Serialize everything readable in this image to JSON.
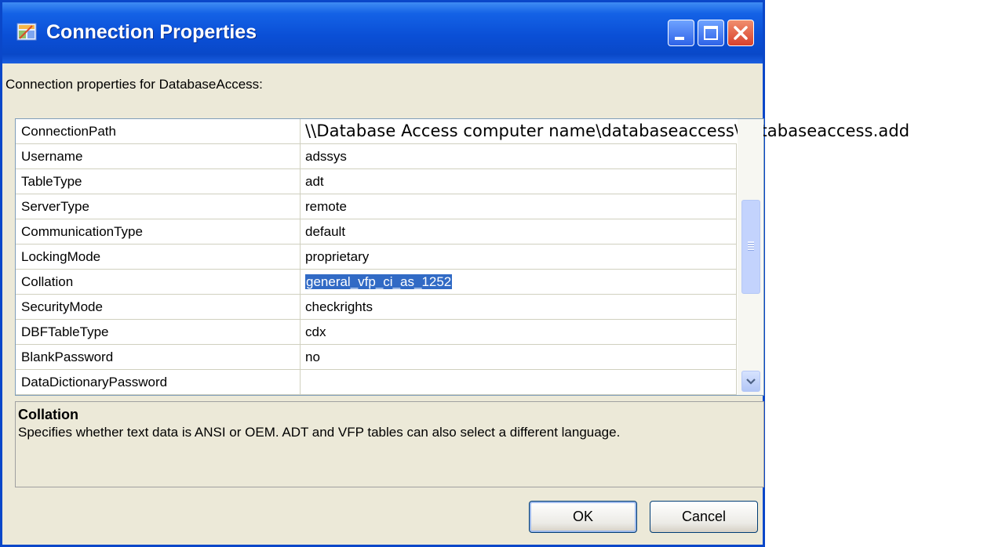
{
  "window": {
    "title": "Connection Properties"
  },
  "description": "Connection properties for DatabaseAccess:",
  "properties": [
    {
      "name": "ConnectionPath",
      "value": "\\\\Database Access computer name\\databaseaccess\\databaseaccess.add"
    },
    {
      "name": "Username",
      "value": "adssys"
    },
    {
      "name": "TableType",
      "value": "adt"
    },
    {
      "name": "ServerType",
      "value": "remote"
    },
    {
      "name": "CommunicationType",
      "value": "default"
    },
    {
      "name": "LockingMode",
      "value": "proprietary"
    },
    {
      "name": "Collation",
      "value": "general_vfp_ci_as_1252"
    },
    {
      "name": "SecurityMode",
      "value": "checkrights"
    },
    {
      "name": "DBFTableType",
      "value": "cdx"
    },
    {
      "name": "BlankPassword",
      "value": "no"
    },
    {
      "name": "DataDictionaryPassword",
      "value": ""
    }
  ],
  "selected_property": "Collation",
  "help": {
    "title": "Collation",
    "text": "Specifies whether text data is ANSI or OEM. ADT and VFP tables can also select a different language."
  },
  "buttons": {
    "ok": "OK",
    "cancel": "Cancel"
  },
  "icons": {
    "app": "connection-properties-icon",
    "ellipsis": "ellipsis-icon",
    "scroll_down": "chevron-down-icon"
  },
  "colors": {
    "titlebar": "#0A4FD6",
    "selection": "#316AC5",
    "dialog_bg": "#ECE9D8"
  }
}
